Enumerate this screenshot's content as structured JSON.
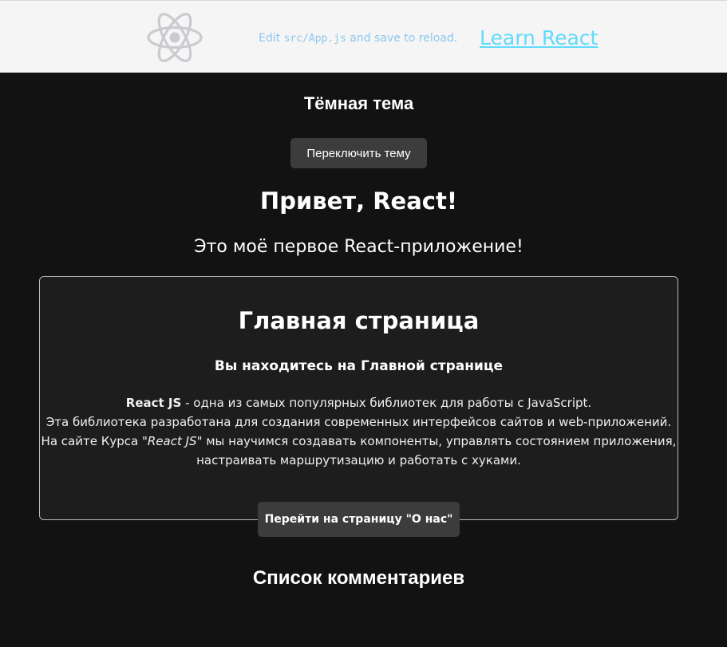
{
  "header": {
    "edit_prefix": "Edit ",
    "edit_code": "src/App.js",
    "edit_suffix": " and save to reload.",
    "learn_link": "Learn React"
  },
  "theme": {
    "title": "Тёмная тема",
    "toggle_label": "Переключить тему"
  },
  "greeting": {
    "title": "Привет, React!",
    "subtitle": "Это моё первое React-приложение!"
  },
  "home_card": {
    "title": "Главная страница",
    "subtitle": "Вы находитесь на Главной странице",
    "line1_strong": "React JS",
    "line1_rest": " - одна из самых популярных библиотек для работы с JavaScript.",
    "line2": "Эта библиотека разработана для создания современных интерфейсов сайтов и web-приложений.",
    "line3_prefix": "На сайте Курса \"",
    "line3_em": "React JS",
    "line3_suffix": "\" мы научимся создавать компоненты, управлять состоянием приложения,",
    "line4": "настраивать маршрутизацию и работать с хуками.",
    "button_label": "Перейти на страницу \"О нас\""
  },
  "comments": {
    "title": "Список комментариев"
  },
  "colors": {
    "header_bg": "#f5f5f5",
    "page_bg": "#121212",
    "card_bg": "#1d1d1d",
    "link": "#61dafb",
    "button_bg": "#3c3c3c"
  },
  "icons": {
    "logo": "react-logo-icon"
  }
}
